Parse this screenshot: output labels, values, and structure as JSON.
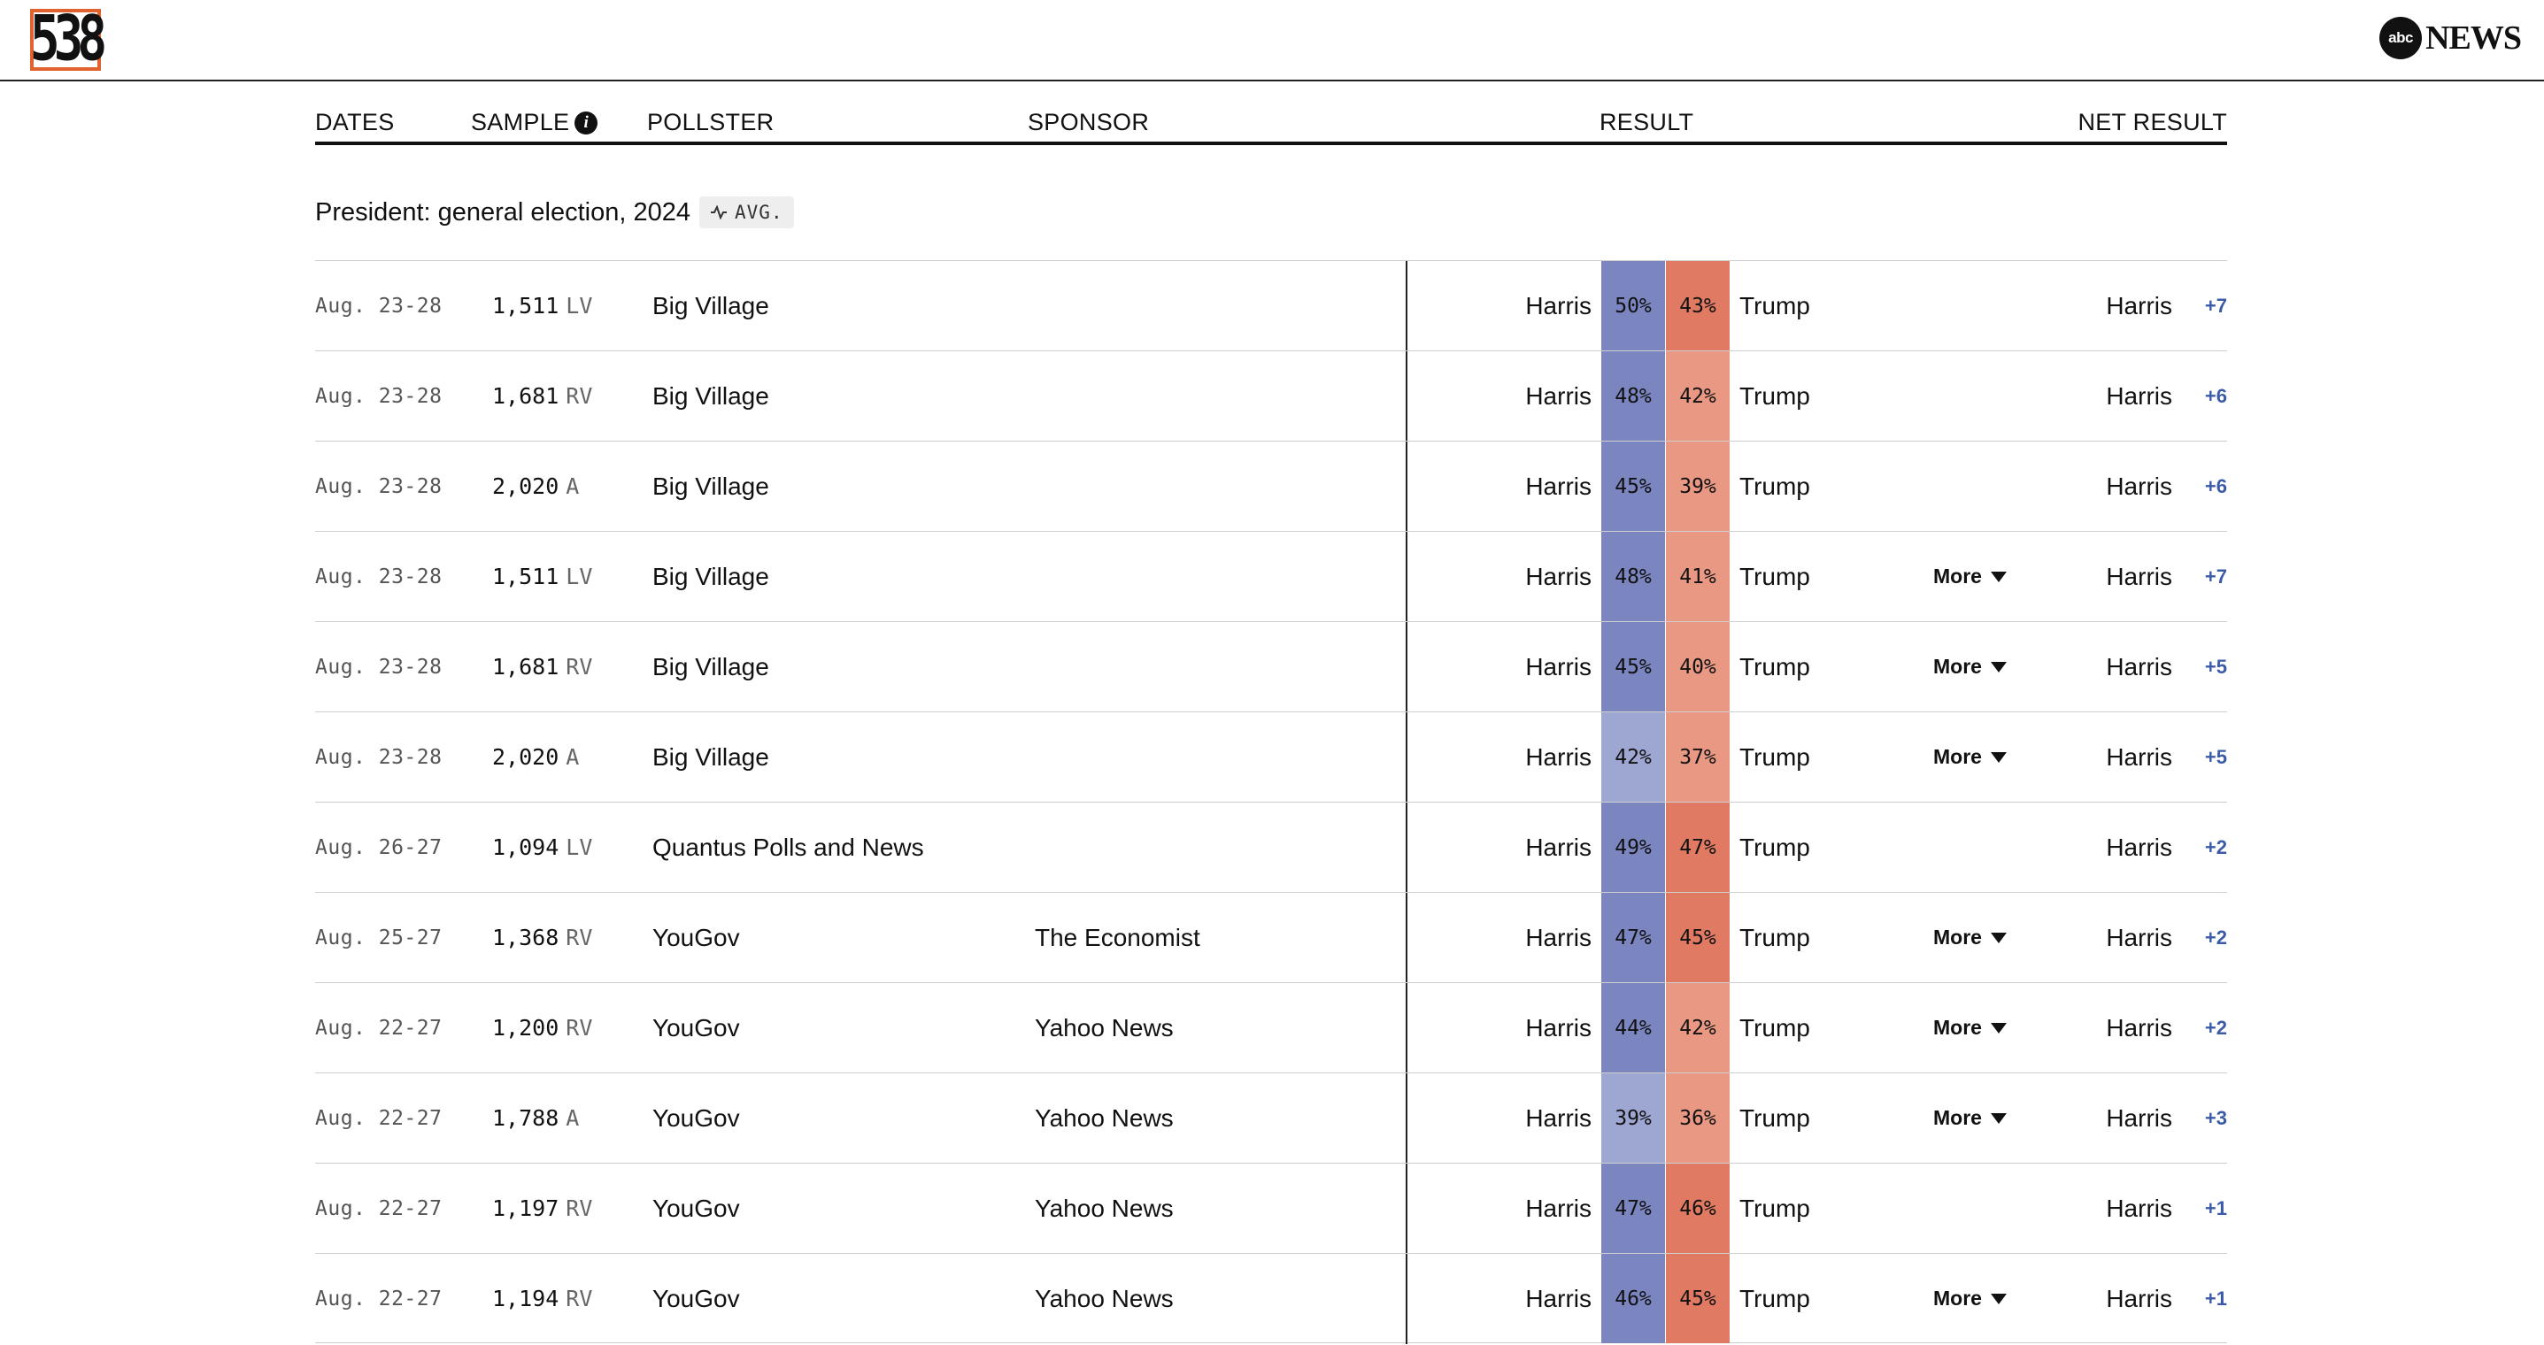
{
  "header": {
    "logo_text": "538",
    "abc_text": "abc",
    "news_text": "NEWS"
  },
  "columns": {
    "dates": "DATES",
    "sample": "SAMPLE",
    "pollster": "POLLSTER",
    "sponsor": "SPONSOR",
    "result": "RESULT",
    "net_result": "NET RESULT",
    "info_glyph": "i"
  },
  "section": {
    "title": "President: general election, 2024",
    "avg_label": "AVG."
  },
  "colors": {
    "dem_strong": "#7b86c0",
    "dem_light": "#9ea6d2",
    "rep_strong": "#e07a62",
    "rep_light": "#e99884",
    "net_dem": "#3b5ba8",
    "logo_border": "#e0622f"
  },
  "more_label": "More",
  "rows": [
    {
      "date": "Aug. 23-28",
      "sample": "1,511",
      "pop": "LV",
      "pollster": "Big Village",
      "sponsor": "",
      "cand1": "Harris",
      "pct1": "50%",
      "pct2": "43%",
      "cand2": "Trump",
      "more": false,
      "net_name": "Harris",
      "net_value": "+7"
    },
    {
      "date": "Aug. 23-28",
      "sample": "1,681",
      "pop": "RV",
      "pollster": "Big Village",
      "sponsor": "",
      "cand1": "Harris",
      "pct1": "48%",
      "pct2": "42%",
      "cand2": "Trump",
      "more": false,
      "net_name": "Harris",
      "net_value": "+6"
    },
    {
      "date": "Aug. 23-28",
      "sample": "2,020",
      "pop": "A",
      "pollster": "Big Village",
      "sponsor": "",
      "cand1": "Harris",
      "pct1": "45%",
      "pct2": "39%",
      "cand2": "Trump",
      "more": false,
      "net_name": "Harris",
      "net_value": "+6"
    },
    {
      "date": "Aug. 23-28",
      "sample": "1,511",
      "pop": "LV",
      "pollster": "Big Village",
      "sponsor": "",
      "cand1": "Harris",
      "pct1": "48%",
      "pct2": "41%",
      "cand2": "Trump",
      "more": true,
      "net_name": "Harris",
      "net_value": "+7"
    },
    {
      "date": "Aug. 23-28",
      "sample": "1,681",
      "pop": "RV",
      "pollster": "Big Village",
      "sponsor": "",
      "cand1": "Harris",
      "pct1": "45%",
      "pct2": "40%",
      "cand2": "Trump",
      "more": true,
      "net_name": "Harris",
      "net_value": "+5"
    },
    {
      "date": "Aug. 23-28",
      "sample": "2,020",
      "pop": "A",
      "pollster": "Big Village",
      "sponsor": "",
      "cand1": "Harris",
      "pct1": "42%",
      "pct2": "37%",
      "cand2": "Trump",
      "more": true,
      "net_name": "Harris",
      "net_value": "+5"
    },
    {
      "date": "Aug. 26-27",
      "sample": "1,094",
      "pop": "LV",
      "pollster": "Quantus Polls and News",
      "sponsor": "",
      "cand1": "Harris",
      "pct1": "49%",
      "pct2": "47%",
      "cand2": "Trump",
      "more": false,
      "net_name": "Harris",
      "net_value": "+2"
    },
    {
      "date": "Aug. 25-27",
      "sample": "1,368",
      "pop": "RV",
      "pollster": "YouGov",
      "sponsor": "The Economist",
      "cand1": "Harris",
      "pct1": "47%",
      "pct2": "45%",
      "cand2": "Trump",
      "more": true,
      "net_name": "Harris",
      "net_value": "+2"
    },
    {
      "date": "Aug. 22-27",
      "sample": "1,200",
      "pop": "RV",
      "pollster": "YouGov",
      "sponsor": "Yahoo News",
      "cand1": "Harris",
      "pct1": "44%",
      "pct2": "42%",
      "cand2": "Trump",
      "more": true,
      "net_name": "Harris",
      "net_value": "+2"
    },
    {
      "date": "Aug. 22-27",
      "sample": "1,788",
      "pop": "A",
      "pollster": "YouGov",
      "sponsor": "Yahoo News",
      "cand1": "Harris",
      "pct1": "39%",
      "pct2": "36%",
      "cand2": "Trump",
      "more": true,
      "net_name": "Harris",
      "net_value": "+3"
    },
    {
      "date": "Aug. 22-27",
      "sample": "1,197",
      "pop": "RV",
      "pollster": "YouGov",
      "sponsor": "Yahoo News",
      "cand1": "Harris",
      "pct1": "47%",
      "pct2": "46%",
      "cand2": "Trump",
      "more": false,
      "net_name": "Harris",
      "net_value": "+1"
    },
    {
      "date": "Aug. 22-27",
      "sample": "1,194",
      "pop": "RV",
      "pollster": "YouGov",
      "sponsor": "Yahoo News",
      "cand1": "Harris",
      "pct1": "46%",
      "pct2": "45%",
      "cand2": "Trump",
      "more": true,
      "net_name": "Harris",
      "net_value": "+1"
    }
  ]
}
